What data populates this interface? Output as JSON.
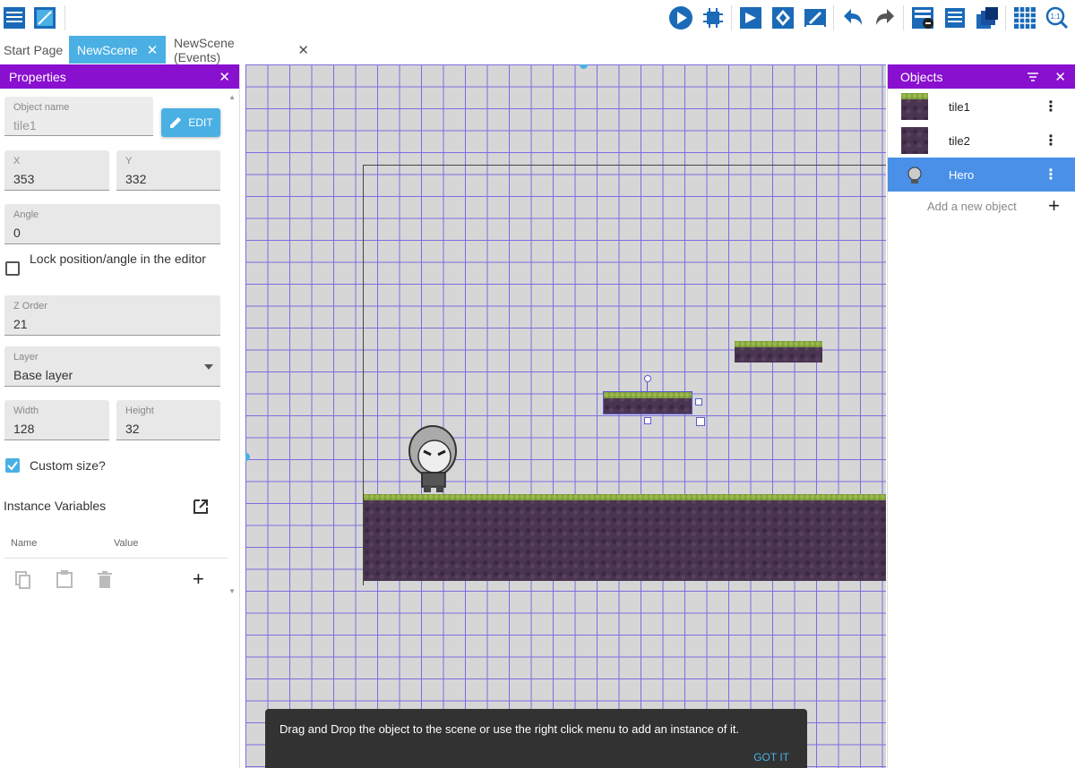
{
  "tabs": [
    {
      "label": "Start Page"
    },
    {
      "label": "NewScene",
      "close": "✕"
    },
    {
      "label": "NewScene (Events)",
      "close": "✕"
    }
  ],
  "properties": {
    "title": "Properties",
    "close": "✕",
    "object_name": {
      "label": "Object name",
      "value": "tile1"
    },
    "edit_label": "EDIT",
    "x": {
      "label": "X",
      "value": "353"
    },
    "y": {
      "label": "Y",
      "value": "332"
    },
    "angle": {
      "label": "Angle",
      "value": "0"
    },
    "lock_label": "Lock position/angle in the editor",
    "lock_checked": false,
    "z_order": {
      "label": "Z Order",
      "value": "21"
    },
    "layer": {
      "label": "Layer",
      "value": "Base layer"
    },
    "width": {
      "label": "Width",
      "value": "128"
    },
    "height": {
      "label": "Height",
      "value": "32"
    },
    "custom_size_label": "Custom size?",
    "custom_size_checked": true,
    "instance_vars_title": "Instance Variables",
    "vars_col_name": "Name",
    "vars_col_value": "Value",
    "add_var": "+"
  },
  "objects_panel": {
    "title": "Objects",
    "close": "✕",
    "items": [
      {
        "name": "tile1",
        "menu": "⋮"
      },
      {
        "name": "tile2",
        "menu": "⋮"
      },
      {
        "name": "Hero",
        "menu": "⋮",
        "selected": true
      }
    ],
    "add_label": "Add a new object",
    "add_icon": "+"
  },
  "snackbar": {
    "message": "Drag and Drop the object to the scene or use the right click menu to add an instance of it.",
    "action": "GOT IT"
  },
  "colors": {
    "panel_header": "#8a10d0",
    "active_tab": "#4ab0e4",
    "selected_object": "#4a90e8",
    "grid_line": "#7a6ee0"
  }
}
